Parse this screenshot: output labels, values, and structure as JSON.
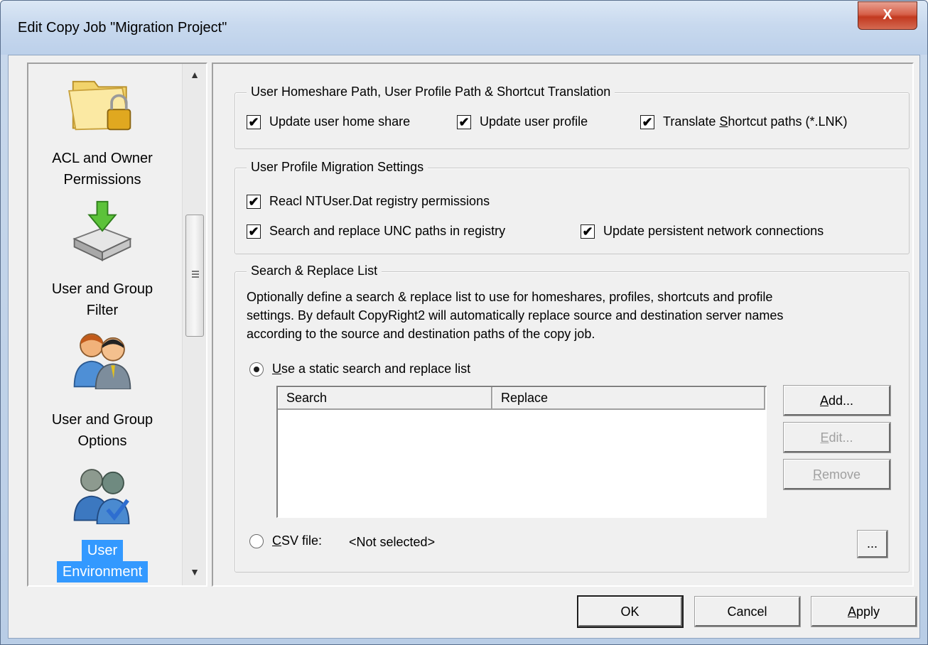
{
  "window": {
    "title": "Edit Copy Job \"Migration Project\"",
    "close_label": "X"
  },
  "nav": {
    "items": [
      {
        "label_line1": "ACL and Owner",
        "label_line2": "Permissions",
        "icon": "folder-lock-icon"
      },
      {
        "label_line1": "User and Group",
        "label_line2": "Filter",
        "icon": "tray-download-icon"
      },
      {
        "label_line1": "User and Group",
        "label_line2": "Options",
        "icon": "users-icon"
      },
      {
        "label_line1": "User",
        "label_line2": "Environment",
        "icon": "user-environment-icon",
        "selected": true
      }
    ],
    "scroll_up": "▲",
    "scroll_down": "▼"
  },
  "homeshare": {
    "title": "User Homeshare Path, User Profile Path & Shortcut Translation",
    "update_home_share": {
      "label": "Update user home share",
      "checked": true
    },
    "update_profile": {
      "label": "Update user profile",
      "checked": true
    },
    "translate_shortcuts": {
      "label_pre": "Translate ",
      "label_ul": "S",
      "label_post": "hortcut paths (*.LNK)",
      "checked": true
    }
  },
  "profile_migration": {
    "title": "User Profile Migration Settings",
    "reacl": {
      "label": "Reacl NTUser.Dat registry permissions",
      "checked": true
    },
    "search_replace_unc": {
      "label": "Search and replace UNC paths in registry",
      "checked": true
    },
    "update_network": {
      "label": "Update persistent network connections",
      "checked": true
    }
  },
  "search_replace": {
    "title": "Search & Replace List",
    "desc_line1": "Optionally define a search & replace list to use for homeshares, profiles, shortcuts and profile",
    "desc_line2": "settings. By default CopyRight2 will automatically replace source and destination server names",
    "desc_line3": "according to the source and destination paths of the copy job.",
    "static_list": {
      "label_ul": "U",
      "label_post": "se a static search and replace list",
      "selected": true
    },
    "columns": [
      "Search",
      "Replace"
    ],
    "add_ul": "A",
    "add_post": "dd...",
    "edit_ul": "E",
    "edit_post": "dit...",
    "remove_ul": "R",
    "remove_post": "emove",
    "csv": {
      "label_ul": "C",
      "label_post": "SV file:",
      "value": "<Not selected>",
      "selected": false
    },
    "browse_label": "..."
  },
  "footer": {
    "ok": "OK",
    "cancel": "Cancel",
    "apply_ul": "A",
    "apply_post": "pply"
  },
  "colors": {
    "selection": "#3399ff",
    "close_red": "#c2391f"
  }
}
